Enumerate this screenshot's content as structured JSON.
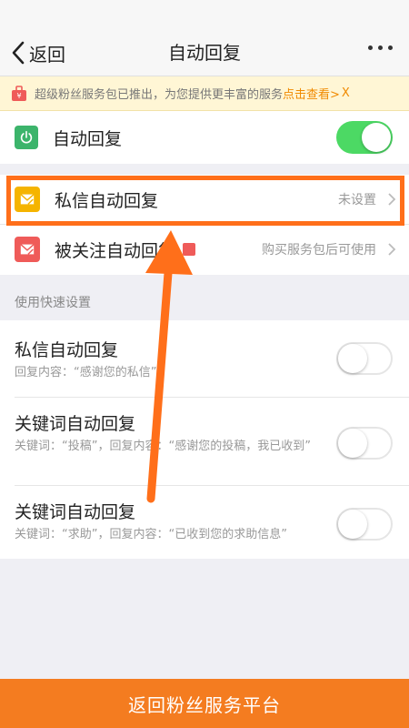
{
  "nav": {
    "back_label": "返回",
    "title": "自动回复",
    "more_icon": "more-dots-icon"
  },
  "banner": {
    "text": "超级粉丝服务包已推出，为您提供更丰富的服务",
    "link": "点击查看>",
    "close": "X",
    "icon": "gift-icon",
    "accent": "#f08a00"
  },
  "auto_reply": {
    "label": "自动回复",
    "enabled": true,
    "icon": "power-icon",
    "icon_color": "#3cb46b"
  },
  "menu": [
    {
      "label": "私信自动回复",
      "value": "未设置",
      "icon": "mail-icon",
      "icon_color": "#f5b400"
    },
    {
      "label": "被关注自动回复",
      "value": "购买服务包后可使用",
      "icon": "mail-icon",
      "icon_color": "#ef5b59",
      "badge_icon": "gift-icon"
    }
  ],
  "quick": {
    "header": "使用快速设置",
    "items": [
      {
        "title": "私信自动回复",
        "desc": "回复内容：“感谢您的私信”",
        "enabled": false
      },
      {
        "title": "关键词自动回复",
        "desc": "关键词：“投稿”，回复内容：“感谢您的投稿，我已收到”",
        "enabled": false
      },
      {
        "title": "关键词自动回复",
        "desc": "关键词：“求助”，回复内容：“已收到您的求助信息”",
        "enabled": false
      }
    ]
  },
  "bottom": {
    "label": "返回粉丝服务平台",
    "color": "#f47c20"
  },
  "annotation": {
    "highlight_color": "#ff6f1a"
  }
}
